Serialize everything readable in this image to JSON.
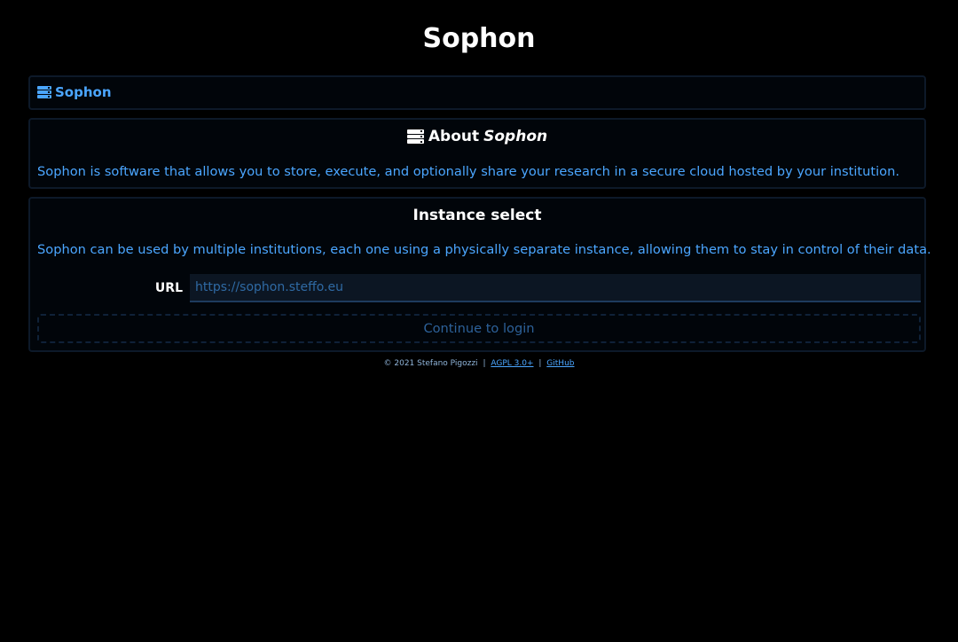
{
  "header": {
    "title": "Sophon"
  },
  "breadcrumb": {
    "icon": "server-icon",
    "label": "Sophon"
  },
  "about": {
    "icon": "server-icon",
    "heading_prefix": "About",
    "heading_name": "Sophon",
    "text": "Sophon is software that allows you to store, execute, and optionally share your research in a secure cloud hosted by your institution."
  },
  "instance_select": {
    "heading": "Instance select",
    "text": "Sophon can be used by multiple institutions, each one using a physically separate instance, allowing them to stay in control of their data.",
    "url_label": "URL",
    "url_value": "",
    "url_placeholder": "https://sophon.steffo.eu",
    "continue_label": "Continue to login"
  },
  "footer": {
    "copyright": "© 2021 Stefano Pigozzi",
    "separator": "|",
    "license_link": "AGPL 3.0+",
    "github_link": "GitHub"
  },
  "colors": {
    "background": "#000000",
    "accent": "#4ba6ff",
    "panel_border": "#0d1929",
    "disabled_text": "#2d6199"
  }
}
